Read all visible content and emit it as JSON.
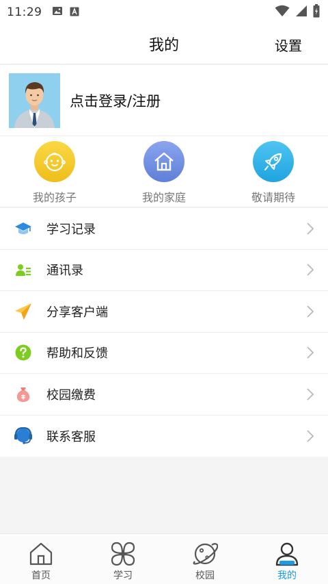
{
  "status_bar": {
    "time": "11:29"
  },
  "header": {
    "title": "我的",
    "settings_label": "设置"
  },
  "profile": {
    "login_label": "点击登录/注册"
  },
  "quick_actions": [
    {
      "label": "我的孩子",
      "icon": "baby-face-icon",
      "color": "#f3c82a"
    },
    {
      "label": "我的家庭",
      "icon": "home-icon",
      "color": "#6f8ee0"
    },
    {
      "label": "敬请期待",
      "icon": "rocket-icon",
      "color": "#35b5ea"
    }
  ],
  "menu": [
    {
      "label": "学习记录",
      "icon": "graduation-cap-icon"
    },
    {
      "label": "通讯录",
      "icon": "contacts-icon"
    },
    {
      "label": "分享客户端",
      "icon": "share-plane-icon"
    },
    {
      "label": "帮助和反馈",
      "icon": "help-icon"
    },
    {
      "label": "校园缴费",
      "icon": "money-bag-icon"
    },
    {
      "label": "联系客服",
      "icon": "headset-icon"
    }
  ],
  "bottom_nav": [
    {
      "label": "首页",
      "icon": "home-icon",
      "active": false
    },
    {
      "label": "学习",
      "icon": "clover-icon",
      "active": false
    },
    {
      "label": "校园",
      "icon": "planet-icon",
      "active": false
    },
    {
      "label": "我的",
      "icon": "user-icon",
      "active": true
    }
  ],
  "colors": {
    "accent": "#1a9be6",
    "help_green": "#7ccd1f",
    "share_yellow": "#f7b32b",
    "service_blue": "#2a7fd4"
  }
}
